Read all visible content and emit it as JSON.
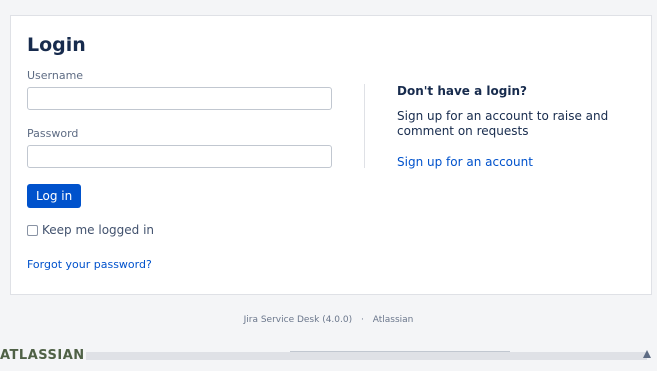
{
  "login": {
    "title": "Login",
    "username_label": "Username",
    "username_value": "",
    "password_label": "Password",
    "password_value": "",
    "submit_label": "Log in",
    "keep_logged_in_label": "Keep me logged in",
    "keep_logged_in_checked": false,
    "forgot_password_link": "Forgot your password?"
  },
  "signup": {
    "title": "Don't have a login?",
    "description": "Sign up for an account to raise and comment on requests",
    "link": "Sign up for an account"
  },
  "footer": {
    "product": "Jira Service Desk (4.0.0)",
    "separator": "·",
    "vendor": "Atlassian"
  },
  "branding": {
    "logo_text": "ATLASSIAN",
    "accent_color": "#0052cc"
  }
}
